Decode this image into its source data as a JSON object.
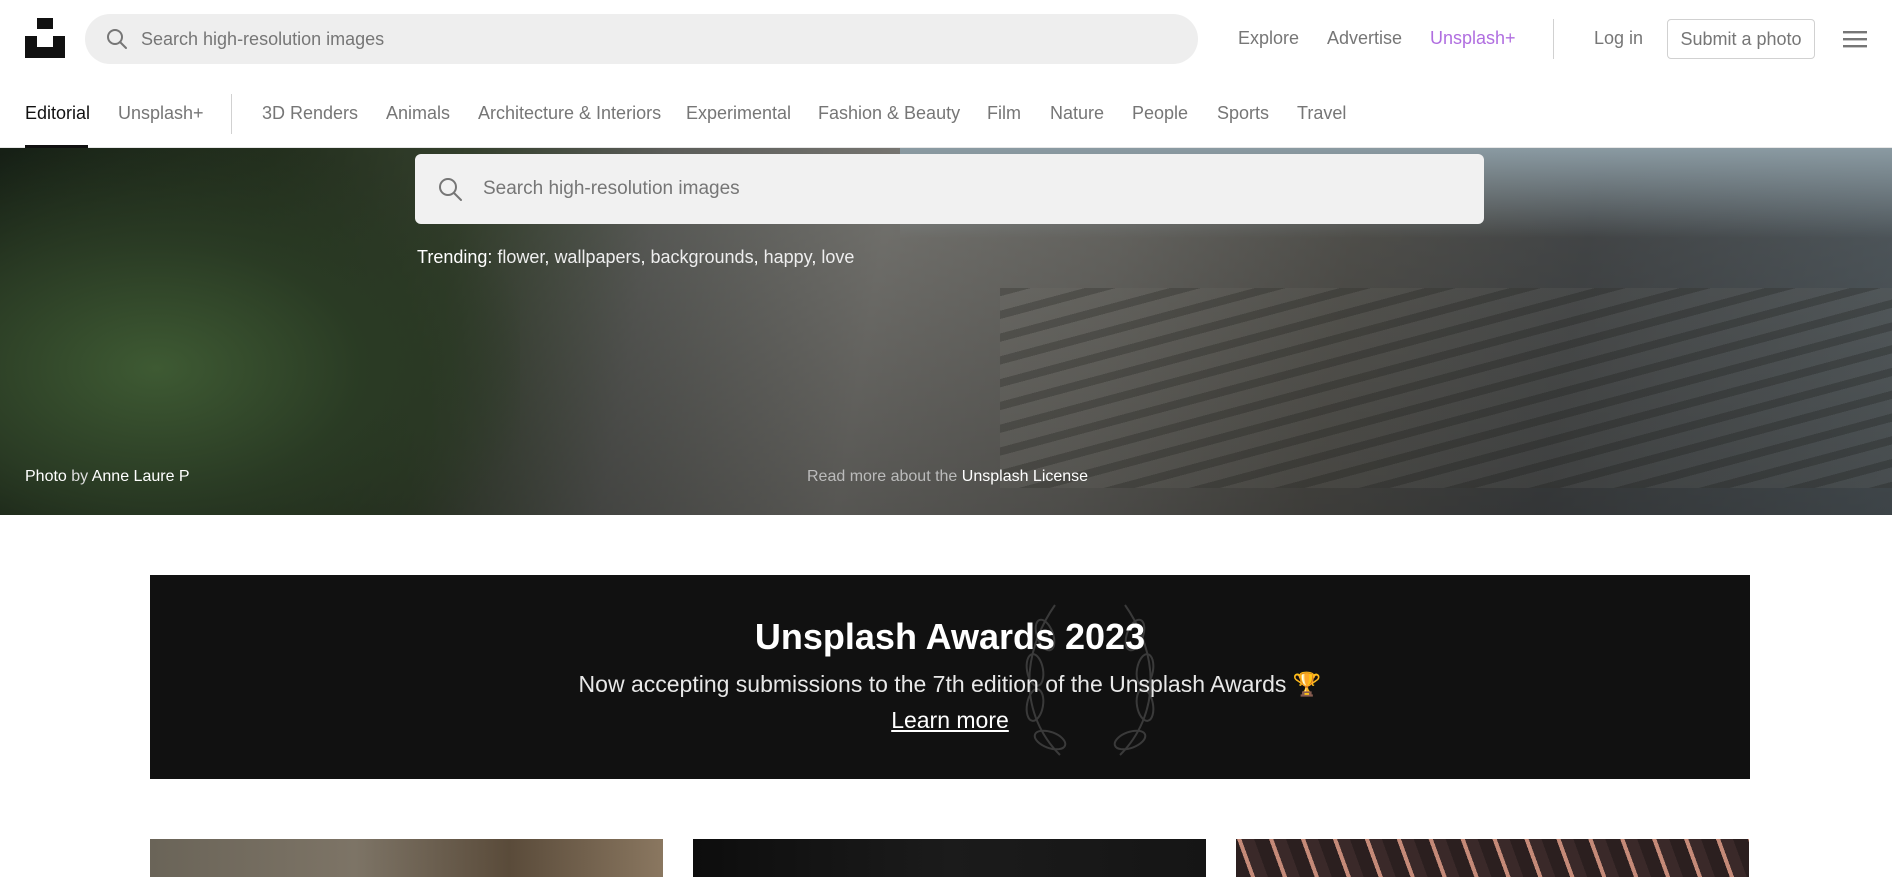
{
  "header": {
    "search_placeholder": "Search high-resolution images",
    "nav": {
      "explore": "Explore",
      "advertise": "Advertise",
      "unsplash_plus": "Unsplash+",
      "login": "Log in",
      "submit": "Submit a photo"
    },
    "accent_color": "#b06ee0"
  },
  "categories": {
    "active": "Editorial",
    "plus": "Unsplash+",
    "items": [
      "3D Renders",
      "Animals",
      "Architecture & Interiors",
      "Experimental",
      "Fashion & Beauty",
      "Film",
      "Nature",
      "People",
      "Sports",
      "Travel"
    ]
  },
  "hero": {
    "search_placeholder": "Search high-resolution images",
    "trending_label": "Trending:",
    "trending_items": [
      "flower",
      "wallpapers",
      "backgrounds",
      "happy",
      "love"
    ],
    "credit_prefix": "Photo",
    "credit_by": "by",
    "credit_author": "Anne Laure P",
    "license_prefix": "Read more about the",
    "license_link": "Unsplash License"
  },
  "awards": {
    "title": "Unsplash Awards 2023",
    "subtitle": "Now accepting submissions to the 7th edition of the Unsplash Awards 🏆",
    "cta": "Learn more"
  }
}
